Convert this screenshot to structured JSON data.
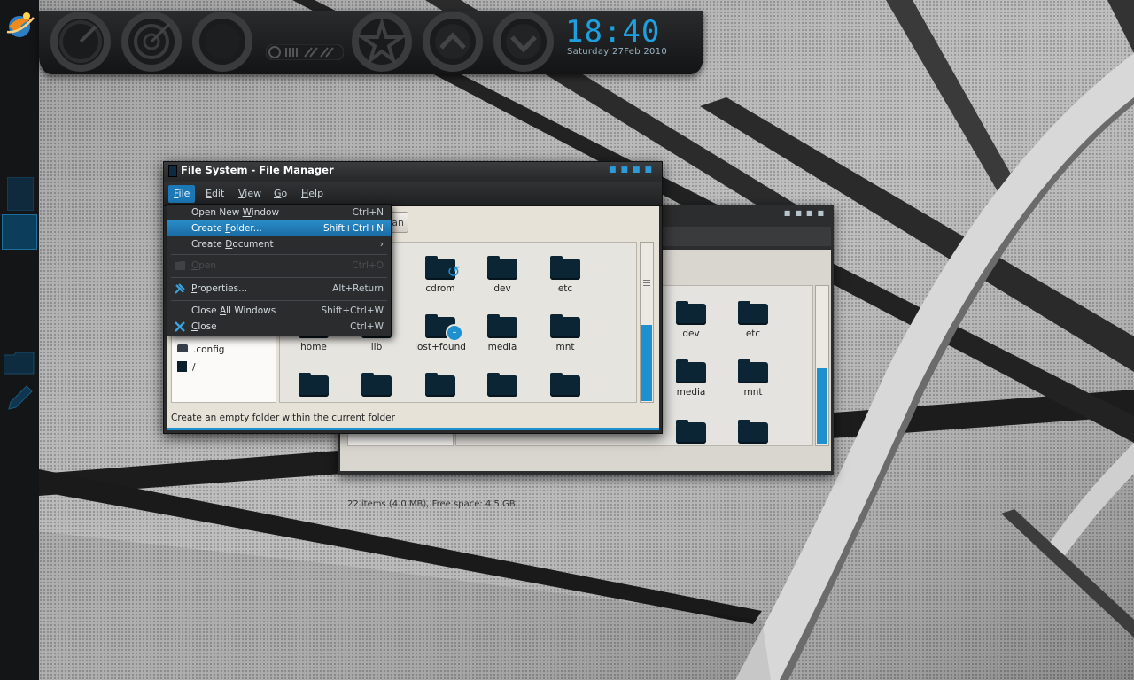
{
  "desktop": {
    "clock": {
      "time": "18:40",
      "date": "Saturday 27Feb 2010"
    },
    "accent_color": "#1e90d0"
  },
  "front_window": {
    "title": "File System - File Manager",
    "menubar": [
      {
        "label_pre": "",
        "mnemonic": "F",
        "label_post": "ile"
      },
      {
        "label_pre": "",
        "mnemonic": "E",
        "label_post": "dit"
      },
      {
        "label_pre": "",
        "mnemonic": "V",
        "label_post": "iew"
      },
      {
        "label_pre": "",
        "mnemonic": "G",
        "label_post": "o"
      },
      {
        "label_pre": "",
        "mnemonic": "H",
        "label_post": "elp"
      }
    ],
    "path_button_partial": "an",
    "sidebar": [
      {
        "label": ".config",
        "icon": "folder-icon"
      },
      {
        "label": "/",
        "icon": "drive-icon"
      }
    ],
    "files_row1": [
      "cdrom",
      "dev",
      "etc"
    ],
    "files_row2": [
      "home",
      "lib",
      "lost+found",
      "media",
      "mnt"
    ],
    "status": "Create an empty folder within the current folder"
  },
  "file_menu": {
    "items": [
      {
        "pre": "Open New ",
        "mn": "W",
        "post": "indow",
        "accel": "Ctrl+N",
        "state": "normal"
      },
      {
        "pre": "Create ",
        "mn": "F",
        "post": "older...",
        "accel": "Shift+Ctrl+N",
        "state": "highlighted"
      },
      {
        "pre": "Create ",
        "mn": "D",
        "post": "ocument",
        "accel": "›",
        "state": "submenu"
      },
      {
        "pre": "",
        "mn": "O",
        "post": "pen",
        "accel": "Ctrl+O",
        "state": "disabled"
      },
      {
        "pre": "",
        "mn": "P",
        "post": "roperties...",
        "accel": "Alt+Return",
        "state": "normal"
      },
      {
        "pre": "Close ",
        "mn": "A",
        "post": "ll Windows",
        "accel": "Shift+Ctrl+W",
        "state": "normal"
      },
      {
        "pre": "",
        "mn": "C",
        "post": "lose",
        "accel": "Ctrl+W",
        "state": "normal"
      }
    ]
  },
  "back_window": {
    "files_row1": [
      "dev",
      "etc"
    ],
    "files_row2": [
      "media",
      "mnt"
    ],
    "status": "22 items (4.0 MB), Free space: 4.5 GB"
  }
}
